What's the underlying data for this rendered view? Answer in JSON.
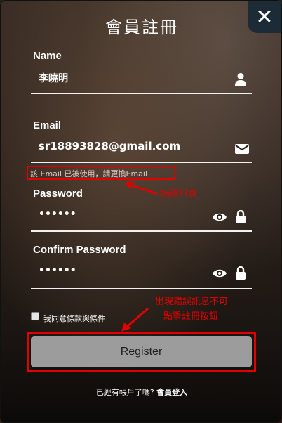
{
  "header": {
    "title": "會員註冊",
    "close_label": "✕"
  },
  "fields": {
    "name": {
      "label": "Name",
      "value": "李曉明"
    },
    "email": {
      "label": "Email",
      "value": "sr18893828@gmail.com",
      "error": "該 Email 已被使用，請更換Email"
    },
    "password": {
      "label": "Password",
      "value": "••••••"
    },
    "confirm": {
      "label": "Confirm Password",
      "value": "••••••"
    }
  },
  "annotations": {
    "error_note": "錯誤訊息",
    "button_note_line1": "出現錯誤訊息不可",
    "button_note_line2": "點擊註冊按鈕"
  },
  "terms": {
    "label": "我同意條款與條件",
    "checked": false
  },
  "register": {
    "label": "Register"
  },
  "footer": {
    "prompt": "已經有帳戶了嗎?",
    "login_link": "會員登入"
  },
  "colors": {
    "annotation": "#e00000",
    "button": "#9c9c9c",
    "close_bg": "#1d2b36"
  }
}
